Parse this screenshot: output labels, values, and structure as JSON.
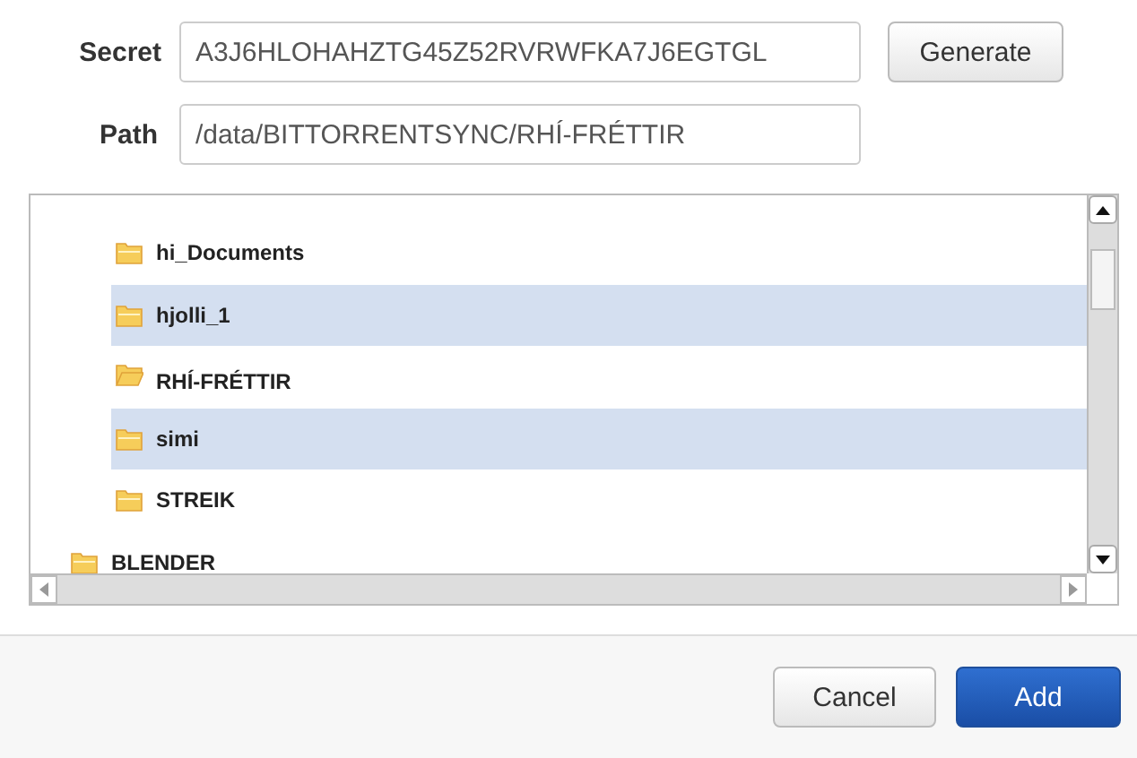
{
  "secret": {
    "label": "Secret",
    "value": "A3J6HLOHAHZTG45Z52RVRWFKA7J6EGTGL"
  },
  "generate_button": "Generate",
  "path": {
    "label": "Path",
    "value": "/data/BITTORRENTSYNC/RHÍ-FRÉTTIR"
  },
  "folder_tree": [
    {
      "children": [
        {
          "name": "hi_Documents",
          "selected": false
        },
        {
          "name": "hjolli_1",
          "selected": false
        },
        {
          "name": "RHÍ-FRÉTTIR",
          "selected": true
        },
        {
          "name": "simi",
          "selected": false
        },
        {
          "name": "STREIK",
          "selected": false
        }
      ]
    },
    {
      "name": "BLENDER",
      "selected": false
    }
  ],
  "buttons": {
    "cancel": "Cancel",
    "add": "Add"
  }
}
